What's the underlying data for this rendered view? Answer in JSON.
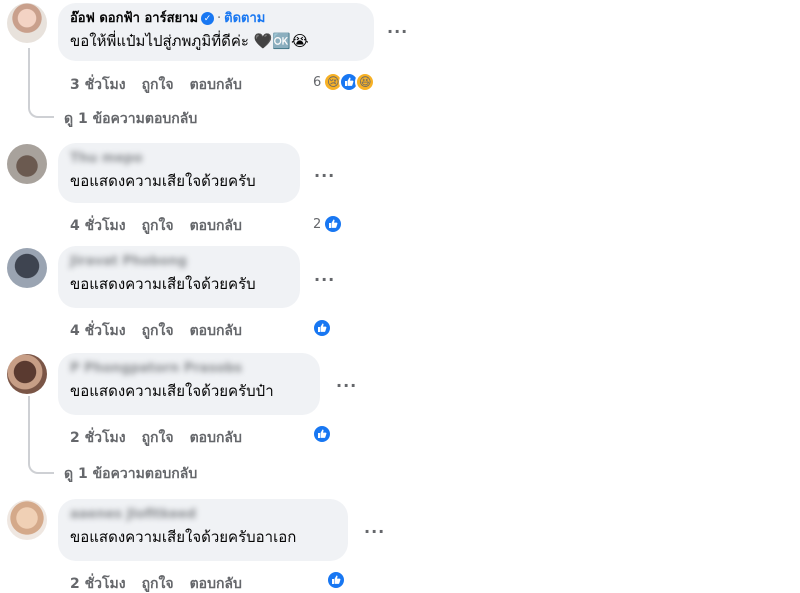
{
  "comments": [
    {
      "author": "อ๊อฟ ดอกฟ้า อาร์สยาม",
      "follow_label": "ติดตาม",
      "text": "ขอให้พี่แป๋มไปสู่ภพภูมิที่ดีค่ะ",
      "text_emoji": "🖤🆗😭",
      "time": "3 ชั่วโมง",
      "like_label": "ถูกใจ",
      "reply_label": "ตอบกลับ",
      "reaction_count": "6",
      "reactions": [
        "sad",
        "like",
        "haha"
      ],
      "view_replies": "ดู 1 ข้อความตอบกลับ"
    },
    {
      "author": "Thu mepo",
      "text": "ขอแสดงความเสียใจด้วยครับ",
      "time": "4 ชั่วโมง",
      "like_label": "ถูกใจ",
      "reply_label": "ตอบกลับ",
      "reaction_count": "2",
      "reactions": [
        "like"
      ]
    },
    {
      "author": "Jiravat Phobong",
      "text": "ขอแสดงความเสียใจด้วยครับ",
      "time": "4 ชั่วโมง",
      "like_label": "ถูกใจ",
      "reply_label": "ตอบกลับ",
      "reaction_count": "",
      "reactions": [
        "like"
      ]
    },
    {
      "author": "P Phongpatorn Prasobs",
      "text": "ขอแสดงความเสียใจด้วยครับป๋า",
      "time": "2 ชั่วโมง",
      "like_label": "ถูกใจ",
      "reply_label": "ตอบกลับ",
      "reaction_count": "",
      "reactions": [
        "like"
      ],
      "view_replies": "ดู 1 ข้อความตอบกลับ"
    },
    {
      "author": "aaenes Jlofitkeed",
      "text": "ขอแสดงความเสียใจด้วยครับอาเอก",
      "time": "2 ชั่วโมง",
      "like_label": "ถูกใจ",
      "reply_label": "ตอบกลับ",
      "reaction_count": "",
      "reactions": [
        "like"
      ]
    }
  ],
  "more_options": "···",
  "colors": {
    "link": "#1877f2",
    "bubble": "#f0f2f5",
    "meta": "#65676b"
  }
}
